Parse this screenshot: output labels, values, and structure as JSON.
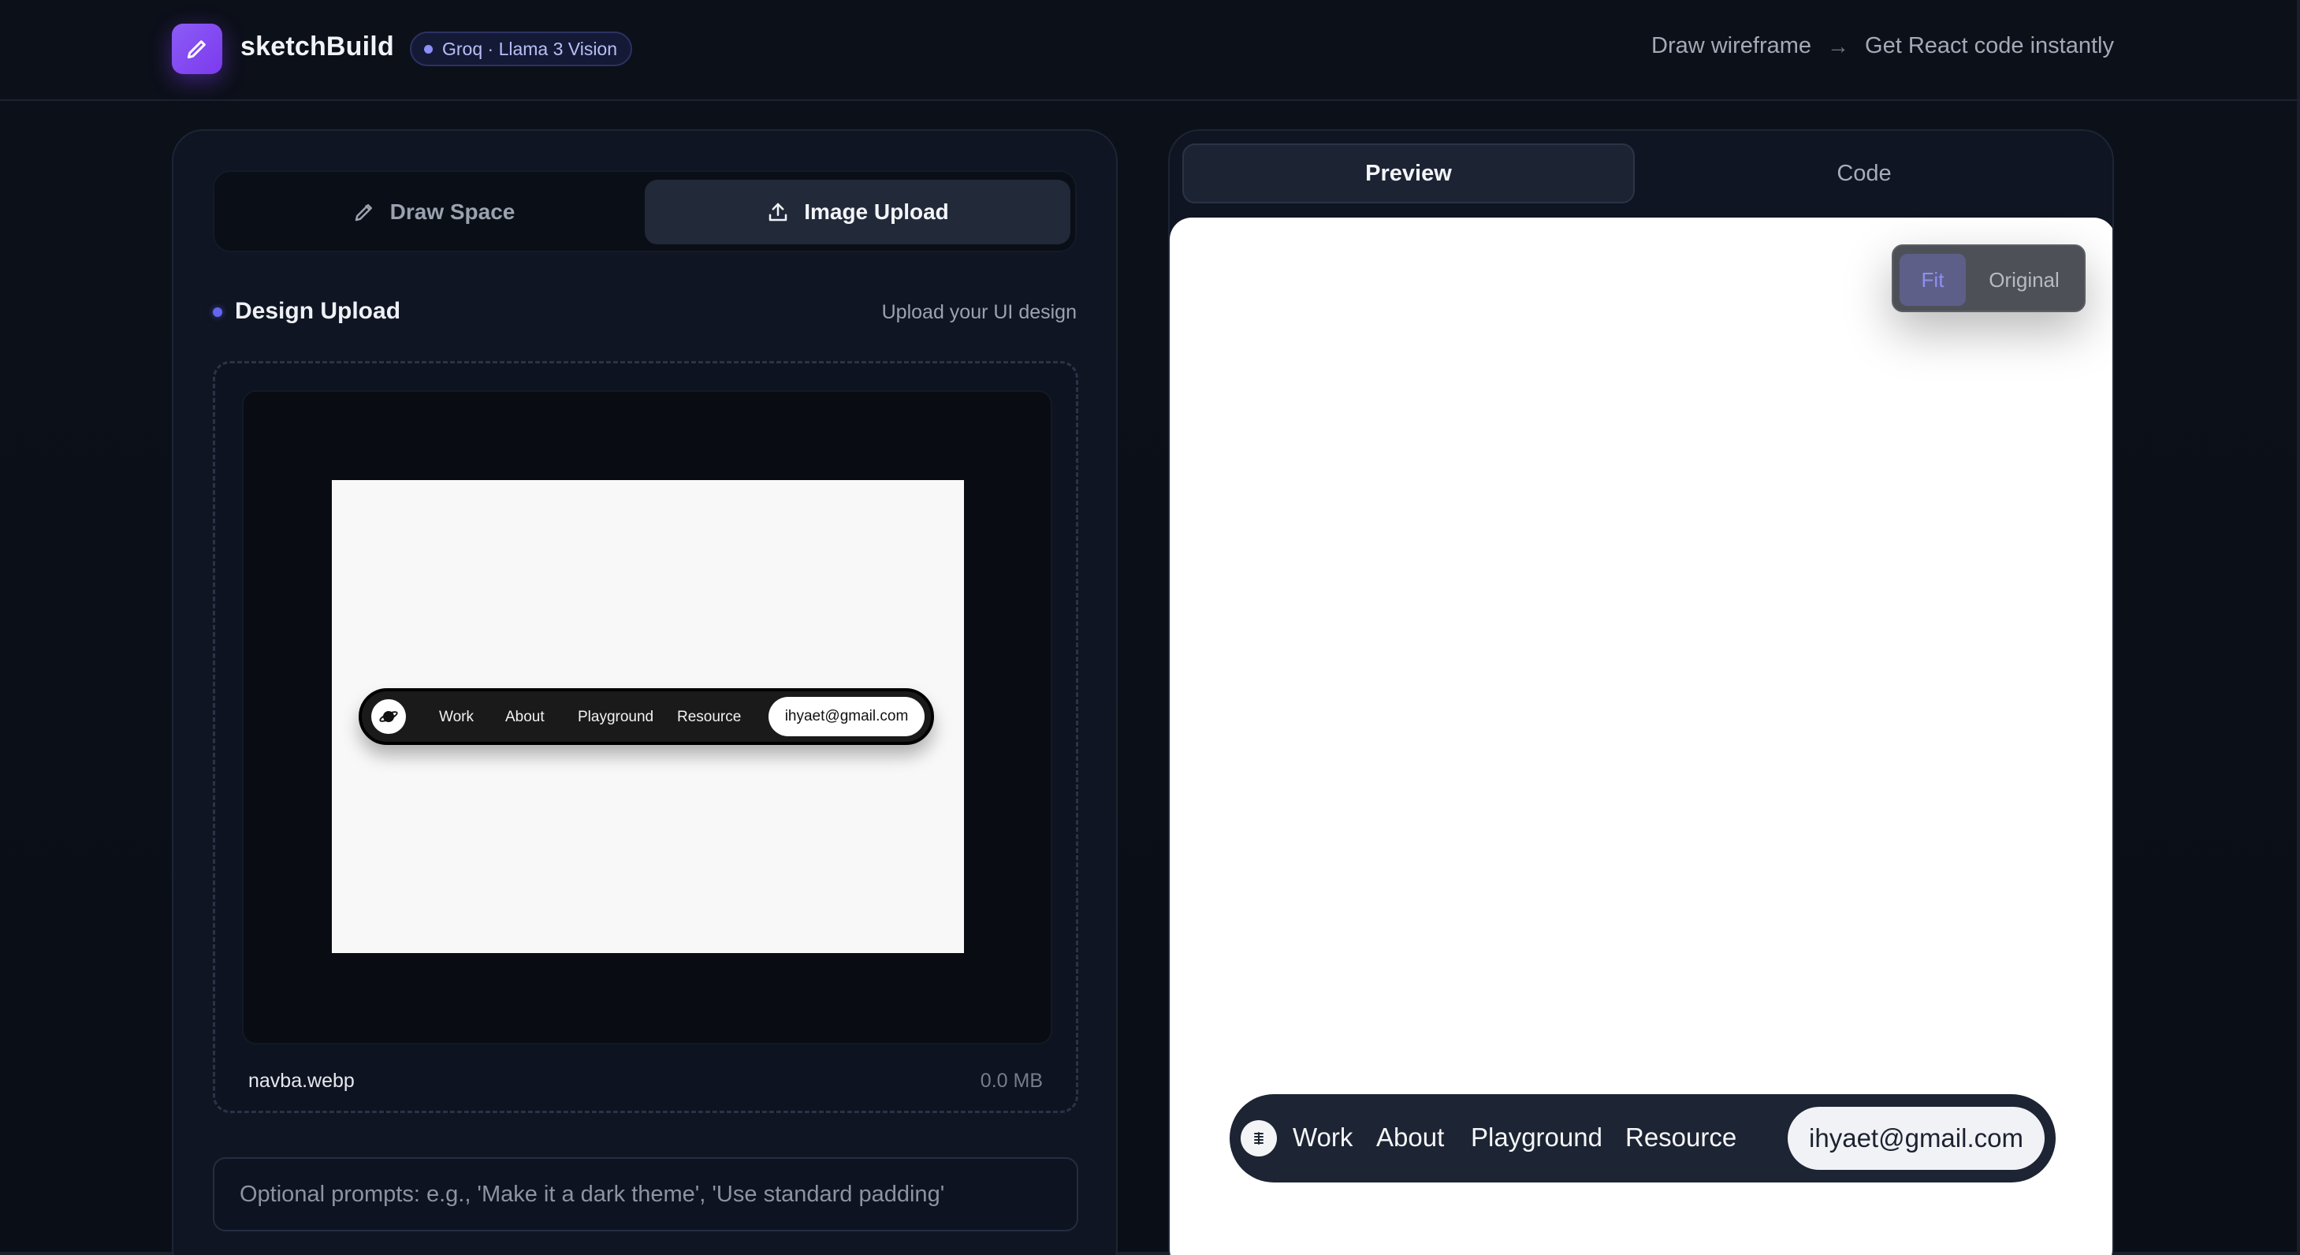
{
  "header": {
    "brand": "sketchBuild",
    "model_badge": "Groq · Llama 3 Vision",
    "tagline_from": "Draw wireframe",
    "tagline_to": "Get React code instantly",
    "accent_color": "#7c3aed"
  },
  "left_panel": {
    "modes": [
      {
        "label": "Draw Space",
        "icon": "pencil-icon",
        "active": false
      },
      {
        "label": "Image Upload",
        "icon": "upload-icon",
        "active": true
      }
    ],
    "section_title": "Design Upload",
    "section_hint": "Upload your UI design",
    "uploaded_image": {
      "nav_links": [
        "Work",
        "About",
        "Playground",
        "Resource"
      ],
      "email": "ihyaet@gmail.com"
    },
    "file": {
      "name": "navba.webp",
      "size": "0.0 MB"
    },
    "prompt": {
      "value": "",
      "placeholder": "Optional prompts: e.g., 'Make it a dark theme', 'Use standard padding'"
    }
  },
  "right_panel": {
    "tabs": [
      {
        "label": "Preview",
        "active": true
      },
      {
        "label": "Code",
        "active": false
      }
    ],
    "zoom": {
      "fit_label": "Fit",
      "original_label": "Original",
      "selected": "Fit"
    },
    "preview_nav": {
      "links": [
        "Work",
        "About",
        "Playground",
        "Resource"
      ],
      "email": "ihyaet@gmail.com"
    }
  }
}
